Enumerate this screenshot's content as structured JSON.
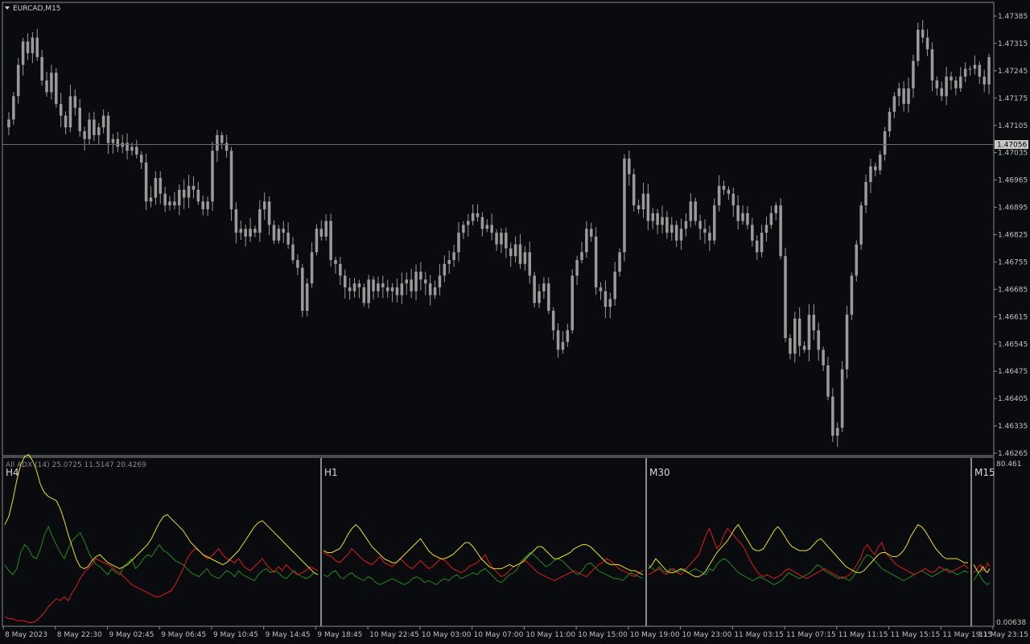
{
  "colors": {
    "background": "#0a0b0f",
    "frame": "#8a8a8a",
    "candle": "#9a9a9a",
    "adx": "#e8e020",
    "plus_di": "#1e8a1e",
    "minus_di": "#e01a1a",
    "price_line": "#6a6a6a",
    "price_tag": "#c8c8c8",
    "separator": "#8a8a8a"
  },
  "header": {
    "symbol": "EURCAD,M15",
    "dropdown_icon": "triangle-down-icon"
  },
  "price_axis": {
    "ticks": [
      "1.47385",
      "1.47315",
      "1.47245",
      "1.47175",
      "1.47105",
      "1.47035",
      "1.46965",
      "1.46895",
      "1.46825",
      "1.46755",
      "1.46685",
      "1.46615",
      "1.46545",
      "1.46475",
      "1.46405",
      "1.46335",
      "1.46265"
    ],
    "current_price": "1.47056"
  },
  "time_axis": {
    "ticks": [
      "8 May 2023",
      "8 May 22:30",
      "9 May 02:45",
      "9 May 06:45",
      "9 May 10:45",
      "9 May 14:45",
      "9 May 18:45",
      "10 May 22:45",
      "10 May 03:00",
      "10 May 07:00",
      "10 May 11:00",
      "10 May 15:00",
      "10 May 19:00",
      "10 May 23:00",
      "11 May 03:15",
      "11 May 07:15",
      "11 May 11:15",
      "11 May 15:15",
      "11 May 19:15",
      "11 May 23:15"
    ]
  },
  "indicator": {
    "label": "All ADX (14) 25.0725 11.5147 20.4269",
    "axis_top": "80.461",
    "axis_bottom": "0.00638",
    "panels": [
      "H4",
      "H1",
      "M30",
      "M15"
    ]
  },
  "chart_data": {
    "type": "candlestick",
    "symbol": "EURCAD",
    "timeframe": "M15",
    "ylim": [
      1.4626,
      1.4745
    ],
    "closes": [
      1.4712,
      1.4718,
      1.4726,
      1.4732,
      1.4729,
      1.4733,
      1.4728,
      1.4722,
      1.4719,
      1.4724,
      1.4716,
      1.4713,
      1.471,
      1.4718,
      1.4715,
      1.4709,
      1.4707,
      1.4712,
      1.4708,
      1.471,
      1.4713,
      1.4706,
      1.4707,
      1.4705,
      1.4706,
      1.4704,
      1.4705,
      1.4703,
      1.4701,
      1.4691,
      1.4692,
      1.4697,
      1.4693,
      1.469,
      1.4691,
      1.469,
      1.4694,
      1.4692,
      1.4695,
      1.4694,
      1.4691,
      1.4689,
      1.4691,
      1.4704,
      1.4708,
      1.4706,
      1.4704,
      1.4689,
      1.4683,
      1.4684,
      1.4682,
      1.4684,
      1.4683,
      1.4689,
      1.4691,
      1.4685,
      1.4681,
      1.4684,
      1.4683,
      1.468,
      1.4676,
      1.4674,
      1.4663,
      1.467,
      1.4678,
      1.4684,
      1.4682,
      1.4686,
      1.4676,
      1.4675,
      1.4672,
      1.4669,
      1.4668,
      1.467,
      1.4669,
      1.4665,
      1.4671,
      1.4668,
      1.467,
      1.4669,
      1.4668,
      1.4669,
      1.4667,
      1.467,
      1.4671,
      1.4668,
      1.4673,
      1.4671,
      1.467,
      1.4667,
      1.4669,
      1.4672,
      1.4675,
      1.4676,
      1.4678,
      1.4683,
      1.4685,
      1.4686,
      1.4688,
      1.4687,
      1.4684,
      1.4685,
      1.4683,
      1.468,
      1.4683,
      1.4679,
      1.4677,
      1.468,
      1.4675,
      1.4678,
      1.4672,
      1.4665,
      1.4668,
      1.467,
      1.4663,
      1.4658,
      1.4653,
      1.4655,
      1.4658,
      1.4672,
      1.4676,
      1.4678,
      1.4684,
      1.4682,
      1.4669,
      1.4668,
      1.4664,
      1.4666,
      1.4673,
      1.4678,
      1.4702,
      1.4698,
      1.469,
      1.4689,
      1.4693,
      1.4686,
      1.4688,
      1.4685,
      1.4687,
      1.4683,
      1.4685,
      1.4681,
      1.4684,
      1.4686,
      1.4691,
      1.4686,
      1.4684,
      1.4683,
      1.4681,
      1.469,
      1.4695,
      1.4694,
      1.4693,
      1.469,
      1.4686,
      1.4688,
      1.4685,
      1.4681,
      1.4678,
      1.4683,
      1.4685,
      1.4688,
      1.469,
      1.4677,
      1.4656,
      1.4652,
      1.4661,
      1.4654,
      1.4653,
      1.4662,
      1.4658,
      1.4653,
      1.4649,
      1.4641,
      1.4631,
      1.4633,
      1.4648,
      1.4662,
      1.4672,
      1.468,
      1.469,
      1.4696,
      1.47,
      1.4699,
      1.4703,
      1.4709,
      1.4714,
      1.4718,
      1.472,
      1.4716,
      1.472,
      1.4727,
      1.4735,
      1.4733,
      1.473,
      1.4722,
      1.472,
      1.4718,
      1.4723,
      1.4722,
      1.472,
      1.4723,
      1.4725,
      1.4725,
      1.4726,
      1.4723,
      1.4721,
      1.4728
    ],
    "current_price": 1.47056,
    "indicator": {
      "name": "All ADX",
      "period": 14,
      "values": [
        25.0725,
        11.5147,
        20.4269
      ],
      "ylim": [
        0.00638,
        80.461
      ],
      "series": [
        {
          "name": "ADX",
          "panels": [
            [
              50,
              54,
              62,
              72,
              80,
              84,
              85,
              82,
              77,
              70,
              66,
              64,
              63,
              62,
              58,
              52,
              45,
              39,
              33,
              29,
              28,
              29,
              32,
              34,
              35,
              33,
              31,
              30,
              29,
              28,
              29,
              30,
              32,
              34,
              36,
              38,
              40,
              43,
              47,
              51,
              54,
              55,
              53,
              51,
              49,
              47,
              44,
              41,
              39,
              37,
              35,
              34,
              33,
              32,
              31,
              30,
              31,
              33,
              35,
              37,
              40,
              43,
              46,
              49,
              51,
              52,
              50,
              48,
              46,
              44,
              42,
              40,
              38,
              36,
              34,
              32,
              30,
              28,
              26,
              25
            ],
            [
              37,
              36,
              36,
              37,
              38,
              41,
              45,
              48,
              50,
              48,
              45,
              42,
              39,
              37,
              35,
              33,
              32,
              31,
              31,
              33,
              35,
              37,
              39,
              41,
              43,
              40,
              37,
              35,
              34,
              33,
              33,
              34,
              35,
              37,
              39,
              41,
              41,
              39,
              36,
              33,
              31,
              29,
              28,
              28,
              28,
              29,
              30,
              29,
              30,
              31,
              33,
              35,
              37,
              39,
              39,
              37,
              35,
              33,
              33,
              34,
              35,
              36,
              38,
              39,
              40,
              40,
              39,
              37,
              35,
              33,
              31,
              30,
              30,
              30,
              29,
              28,
              27,
              27,
              26,
              25
            ],
            [
              28,
              30,
              33,
              31,
              29,
              27,
              26,
              26,
              27,
              28,
              27,
              26,
              25,
              24,
              24,
              25,
              27,
              30,
              33,
              36,
              38,
              40,
              42,
              45,
              48,
              50,
              47,
              44,
              41,
              38,
              37,
              37,
              38,
              41,
              44,
              47,
              49,
              47,
              44,
              41,
              39,
              38,
              37,
              37,
              37,
              38,
              40,
              42,
              43,
              41,
              39,
              37,
              35,
              33,
              31,
              29,
              28,
              27,
              26,
              26,
              27,
              29,
              31,
              33,
              35,
              36,
              36,
              35,
              34,
              34,
              35,
              37,
              40,
              44,
              47,
              50,
              49,
              47,
              44,
              41,
              38,
              36,
              34,
              33,
              33,
              33,
              33,
              32,
              31,
              31
            ],
            [
              30,
              28,
              26,
              27,
              29,
              27,
              26,
              28
            ]
          ]
        },
        {
          "name": "+DI",
          "panels": [
            [
              30,
              27,
              25,
              28,
              36,
              40,
              38,
              34,
              33,
              38,
              45,
              49,
              44,
              40,
              36,
              33,
              38,
              42,
              44,
              46,
              42,
              37,
              33,
              30,
              29,
              27,
              25,
              28,
              26,
              25,
              29,
              31,
              33,
              28,
              30,
              33,
              35,
              34,
              37,
              40,
              37,
              36,
              34,
              32,
              31,
              30,
              28,
              26,
              25,
              24,
              26,
              28,
              25,
              24,
              23,
              25,
              27,
              26,
              24,
              27,
              25,
              24,
              23,
              22,
              25,
              27,
              28,
              26,
              27,
              26,
              24,
              23,
              25,
              27,
              25,
              24,
              23,
              24,
              26,
              25
            ],
            [
              25,
              24,
              26,
              27,
              24,
              23,
              25,
              26,
              24,
              23,
              22,
              24,
              23,
              21,
              20,
              21,
              22,
              23,
              22,
              21,
              20,
              21,
              23,
              24,
              23,
              21,
              22,
              21,
              20,
              22,
              23,
              22,
              24,
              25,
              23,
              24,
              25,
              26,
              25,
              27,
              28,
              26,
              24,
              22,
              21,
              23,
              25,
              26,
              28,
              32,
              34,
              36,
              35,
              33,
              31,
              29,
              30,
              32,
              33,
              32,
              30,
              28,
              26,
              25,
              27,
              30,
              31,
              29,
              27,
              26,
              25,
              24,
              23,
              23,
              22,
              24,
              26,
              25,
              24,
              23
            ],
            [
              30,
              28,
              27,
              29,
              27,
              26,
              28,
              27,
              26,
              27,
              28,
              26,
              27,
              28,
              27,
              26,
              25,
              28,
              27,
              30,
              32,
              33,
              32,
              30,
              28,
              26,
              25,
              24,
              23,
              22,
              23,
              24,
              23,
              22,
              21,
              20,
              21,
              22,
              24,
              26,
              25,
              24,
              23,
              24,
              25,
              26,
              28,
              30,
              29,
              27,
              26,
              25,
              24,
              23,
              24,
              23,
              22,
              24,
              27,
              30,
              33,
              35,
              34,
              32,
              30,
              28,
              27,
              26,
              25,
              24,
              23,
              22,
              23,
              24,
              25,
              26,
              27,
              26,
              25,
              24,
              25,
              26,
              27,
              28,
              27,
              26,
              25,
              26,
              27,
              26
            ],
            [
              22,
              24,
              26,
              24,
              22,
              21,
              20,
              21
            ]
          ]
        },
        {
          "name": "-DI",
          "panels": [
            [
              4,
              3,
              3,
              2,
              2,
              2,
              1,
              1,
              2,
              4,
              6,
              9,
              11,
              13,
              12,
              14,
              12,
              16,
              19,
              23,
              26,
              28,
              30,
              33,
              32,
              31,
              30,
              29,
              27,
              26,
              24,
              22,
              20,
              19,
              18,
              17,
              16,
              15,
              14,
              14,
              15,
              16,
              17,
              20,
              24,
              28,
              33,
              36,
              38,
              37,
              35,
              33,
              34,
              36,
              38,
              35,
              33,
              32,
              31,
              33,
              30,
              28,
              27,
              29,
              31,
              33,
              30,
              28,
              26,
              29,
              27,
              30,
              28,
              26,
              25,
              26,
              27,
              29,
              28,
              27
            ],
            [
              36,
              35,
              34,
              32,
              31,
              33,
              35,
              38,
              36,
              34,
              32,
              31,
              30,
              32,
              34,
              31,
              30,
              29,
              31,
              33,
              31,
              29,
              28,
              30,
              32,
              30,
              28,
              29,
              31,
              33,
              32,
              30,
              28,
              27,
              26,
              27,
              29,
              30,
              31,
              33,
              35,
              31,
              28,
              26,
              24,
              25,
              27,
              29,
              30,
              31,
              32,
              30,
              28,
              26,
              25,
              24,
              23,
              22,
              23,
              24,
              25,
              26,
              27,
              26,
              25,
              24,
              26,
              28,
              30,
              31,
              33,
              32,
              30,
              28,
              27,
              26,
              25,
              24,
              26,
              27
            ],
            [
              25,
              26,
              27,
              28,
              26,
              25,
              27,
              28,
              26,
              25,
              27,
              29,
              31,
              33,
              35,
              40,
              45,
              48,
              43,
              38,
              40,
              45,
              48,
              46,
              44,
              42,
              40,
              37,
              33,
              30,
              27,
              25,
              24,
              25,
              24,
              23,
              24,
              25,
              27,
              28,
              27,
              26,
              25,
              24,
              23,
              24,
              25,
              26,
              27,
              28,
              27,
              26,
              25,
              24,
              23,
              24,
              25,
              27,
              30,
              33,
              38,
              40,
              37,
              35,
              39,
              41,
              36,
              34,
              32,
              30,
              29,
              28,
              27,
              26,
              25,
              26,
              27,
              28,
              27,
              26,
              27,
              29,
              28,
              27,
              26,
              27,
              28,
              29,
              30,
              28
            ],
            [
              26,
              27,
              29,
              30,
              27,
              28,
              31,
              29
            ]
          ]
        }
      ]
    }
  }
}
